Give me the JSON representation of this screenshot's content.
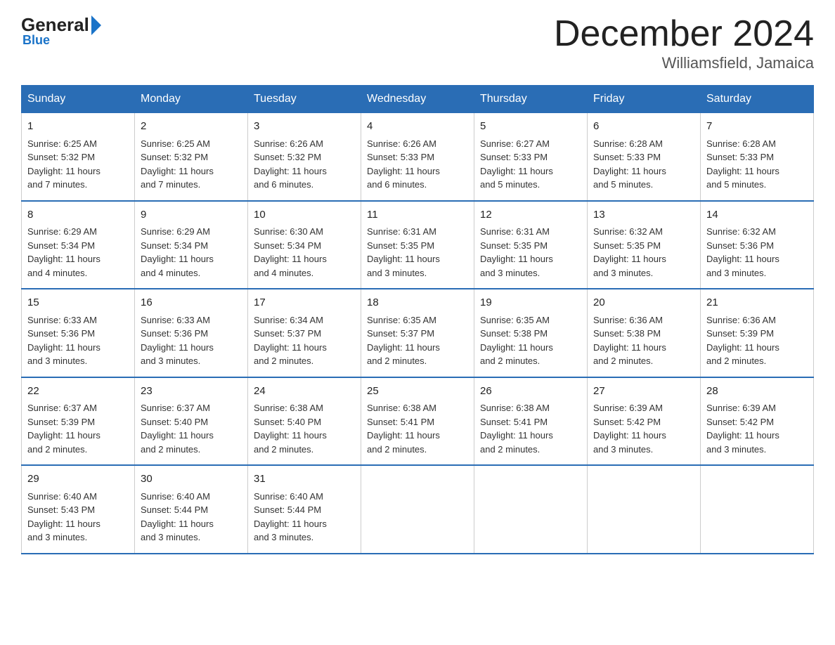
{
  "header": {
    "logo_general": "General",
    "logo_blue": "Blue",
    "title": "December 2024",
    "subtitle": "Williamsfield, Jamaica"
  },
  "days_of_week": [
    "Sunday",
    "Monday",
    "Tuesday",
    "Wednesday",
    "Thursday",
    "Friday",
    "Saturday"
  ],
  "weeks": [
    [
      {
        "day": "1",
        "sunrise": "6:25 AM",
        "sunset": "5:32 PM",
        "daylight": "11 hours and 7 minutes."
      },
      {
        "day": "2",
        "sunrise": "6:25 AM",
        "sunset": "5:32 PM",
        "daylight": "11 hours and 7 minutes."
      },
      {
        "day": "3",
        "sunrise": "6:26 AM",
        "sunset": "5:32 PM",
        "daylight": "11 hours and 6 minutes."
      },
      {
        "day": "4",
        "sunrise": "6:26 AM",
        "sunset": "5:33 PM",
        "daylight": "11 hours and 6 minutes."
      },
      {
        "day": "5",
        "sunrise": "6:27 AM",
        "sunset": "5:33 PM",
        "daylight": "11 hours and 5 minutes."
      },
      {
        "day": "6",
        "sunrise": "6:28 AM",
        "sunset": "5:33 PM",
        "daylight": "11 hours and 5 minutes."
      },
      {
        "day": "7",
        "sunrise": "6:28 AM",
        "sunset": "5:33 PM",
        "daylight": "11 hours and 5 minutes."
      }
    ],
    [
      {
        "day": "8",
        "sunrise": "6:29 AM",
        "sunset": "5:34 PM",
        "daylight": "11 hours and 4 minutes."
      },
      {
        "day": "9",
        "sunrise": "6:29 AM",
        "sunset": "5:34 PM",
        "daylight": "11 hours and 4 minutes."
      },
      {
        "day": "10",
        "sunrise": "6:30 AM",
        "sunset": "5:34 PM",
        "daylight": "11 hours and 4 minutes."
      },
      {
        "day": "11",
        "sunrise": "6:31 AM",
        "sunset": "5:35 PM",
        "daylight": "11 hours and 3 minutes."
      },
      {
        "day": "12",
        "sunrise": "6:31 AM",
        "sunset": "5:35 PM",
        "daylight": "11 hours and 3 minutes."
      },
      {
        "day": "13",
        "sunrise": "6:32 AM",
        "sunset": "5:35 PM",
        "daylight": "11 hours and 3 minutes."
      },
      {
        "day": "14",
        "sunrise": "6:32 AM",
        "sunset": "5:36 PM",
        "daylight": "11 hours and 3 minutes."
      }
    ],
    [
      {
        "day": "15",
        "sunrise": "6:33 AM",
        "sunset": "5:36 PM",
        "daylight": "11 hours and 3 minutes."
      },
      {
        "day": "16",
        "sunrise": "6:33 AM",
        "sunset": "5:36 PM",
        "daylight": "11 hours and 3 minutes."
      },
      {
        "day": "17",
        "sunrise": "6:34 AM",
        "sunset": "5:37 PM",
        "daylight": "11 hours and 2 minutes."
      },
      {
        "day": "18",
        "sunrise": "6:35 AM",
        "sunset": "5:37 PM",
        "daylight": "11 hours and 2 minutes."
      },
      {
        "day": "19",
        "sunrise": "6:35 AM",
        "sunset": "5:38 PM",
        "daylight": "11 hours and 2 minutes."
      },
      {
        "day": "20",
        "sunrise": "6:36 AM",
        "sunset": "5:38 PM",
        "daylight": "11 hours and 2 minutes."
      },
      {
        "day": "21",
        "sunrise": "6:36 AM",
        "sunset": "5:39 PM",
        "daylight": "11 hours and 2 minutes."
      }
    ],
    [
      {
        "day": "22",
        "sunrise": "6:37 AM",
        "sunset": "5:39 PM",
        "daylight": "11 hours and 2 minutes."
      },
      {
        "day": "23",
        "sunrise": "6:37 AM",
        "sunset": "5:40 PM",
        "daylight": "11 hours and 2 minutes."
      },
      {
        "day": "24",
        "sunrise": "6:38 AM",
        "sunset": "5:40 PM",
        "daylight": "11 hours and 2 minutes."
      },
      {
        "day": "25",
        "sunrise": "6:38 AM",
        "sunset": "5:41 PM",
        "daylight": "11 hours and 2 minutes."
      },
      {
        "day": "26",
        "sunrise": "6:38 AM",
        "sunset": "5:41 PM",
        "daylight": "11 hours and 2 minutes."
      },
      {
        "day": "27",
        "sunrise": "6:39 AM",
        "sunset": "5:42 PM",
        "daylight": "11 hours and 3 minutes."
      },
      {
        "day": "28",
        "sunrise": "6:39 AM",
        "sunset": "5:42 PM",
        "daylight": "11 hours and 3 minutes."
      }
    ],
    [
      {
        "day": "29",
        "sunrise": "6:40 AM",
        "sunset": "5:43 PM",
        "daylight": "11 hours and 3 minutes."
      },
      {
        "day": "30",
        "sunrise": "6:40 AM",
        "sunset": "5:44 PM",
        "daylight": "11 hours and 3 minutes."
      },
      {
        "day": "31",
        "sunrise": "6:40 AM",
        "sunset": "5:44 PM",
        "daylight": "11 hours and 3 minutes."
      },
      null,
      null,
      null,
      null
    ]
  ],
  "labels": {
    "sunrise": "Sunrise:",
    "sunset": "Sunset:",
    "daylight": "Daylight:"
  }
}
